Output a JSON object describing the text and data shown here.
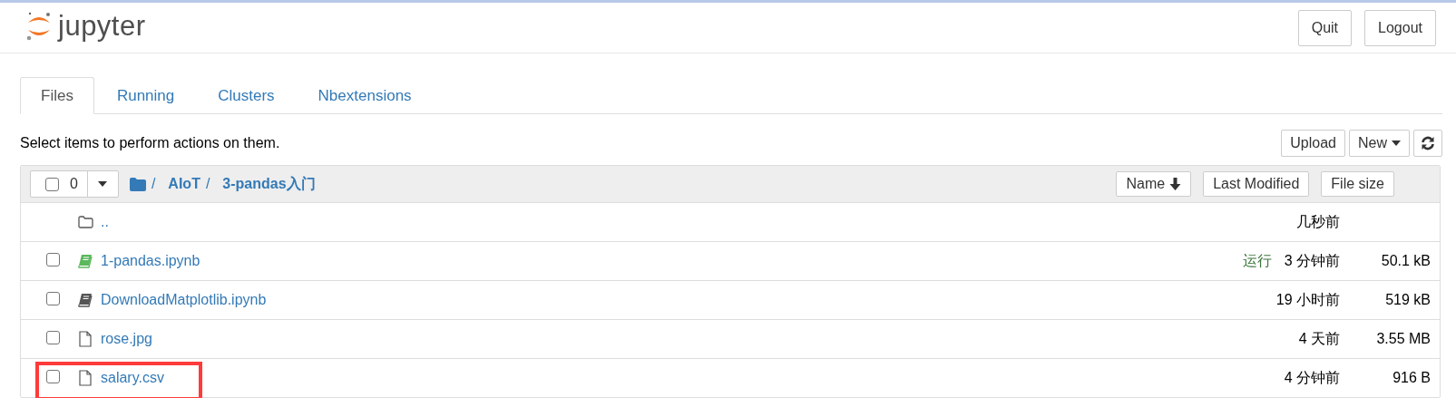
{
  "header": {
    "logo_text": "jupyter",
    "buttons": [
      "Quit",
      "Logout"
    ]
  },
  "tabs": [
    {
      "label": "Files",
      "selected": true
    },
    {
      "label": "Running",
      "selected": false
    },
    {
      "label": "Clusters",
      "selected": false
    },
    {
      "label": "Nbextensions",
      "selected": false
    }
  ],
  "hint": "Select items to perform actions on them.",
  "actions": {
    "upload": "Upload",
    "new": "New"
  },
  "list_header": {
    "select_all": {
      "checked": false,
      "count": "0"
    },
    "separator": "/",
    "breadcrumb": [
      "AIoT",
      "3-pandas入门"
    ],
    "sort_buttons": [
      "Name",
      "Last Modified",
      "File size"
    ]
  },
  "rows": [
    {
      "kind": "parent",
      "name": "..",
      "modified": "几秒前"
    },
    {
      "kind": "notebook",
      "name": "1-pandas.ipynb",
      "running": true,
      "status": "运行",
      "modified": "3 分钟前",
      "size": "50.1 kB",
      "checked": false,
      "highlighted": false
    },
    {
      "kind": "notebook",
      "name": "DownloadMatplotlib.ipynb",
      "running": false,
      "modified": "19 小时前",
      "size": "519 kB",
      "checked": false,
      "highlighted": false
    },
    {
      "kind": "file",
      "name": "rose.jpg",
      "modified": "4 天前",
      "size": "3.55 MB",
      "checked": false,
      "highlighted": false
    },
    {
      "kind": "file",
      "name": "salary.csv",
      "modified": "4 分钟前",
      "size": "916 B",
      "checked": false,
      "highlighted": true
    }
  ]
}
